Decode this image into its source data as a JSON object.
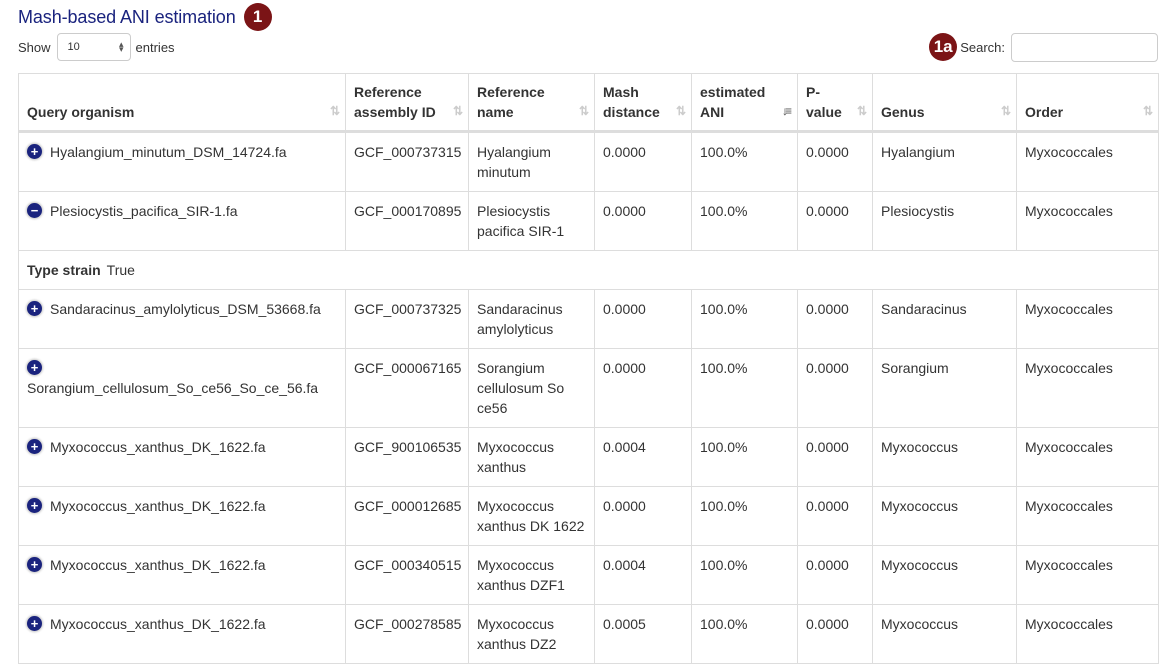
{
  "header": {
    "title": "Mash-based ANI estimation",
    "badge_main": "1",
    "badge_search": "1a"
  },
  "length_control": {
    "prefix": "Show",
    "selected": "10",
    "suffix": "entries"
  },
  "search": {
    "label": "Search:",
    "value": "",
    "placeholder": ""
  },
  "table": {
    "columns": [
      {
        "label": "Query organism",
        "sort": "both"
      },
      {
        "label": "Reference assembly ID",
        "sort": "both"
      },
      {
        "label": "Reference name",
        "sort": "both"
      },
      {
        "label": "Mash distance",
        "sort": "both"
      },
      {
        "label": "estimated ANI",
        "sort": "desc"
      },
      {
        "label": "P-value",
        "sort": "both"
      },
      {
        "label": "Genus",
        "sort": "both"
      },
      {
        "label": "Order",
        "sort": "both"
      }
    ],
    "rows": [
      {
        "expanded": false,
        "query": "Hyalangium_minutum_DSM_14724.fa",
        "assembly": "GCF_000737315",
        "name": "Hyalangium minutum",
        "distance": "0.0000",
        "ani": "100.0%",
        "pvalue": "0.0000",
        "genus": "Hyalangium",
        "order": "Myxococcales"
      },
      {
        "expanded": true,
        "query": "Plesiocystis_pacifica_SIR-1.fa",
        "assembly": "GCF_000170895",
        "name": "Plesiocystis pacifica SIR-1",
        "distance": "0.0000",
        "ani": "100.0%",
        "pvalue": "0.0000",
        "genus": "Plesiocystis",
        "order": "Myxococcales"
      },
      {
        "expanded": false,
        "query": "Sandaracinus_amylolyticus_DSM_53668.fa",
        "assembly": "GCF_000737325",
        "name": "Sandaracinus amylolyticus",
        "distance": "0.0000",
        "ani": "100.0%",
        "pvalue": "0.0000",
        "genus": "Sandaracinus",
        "order": "Myxococcales"
      },
      {
        "expanded": false,
        "query": "Sorangium_cellulosum_So_ce56_So_ce_56.fa",
        "assembly": "GCF_000067165",
        "name": "Sorangium cellulosum So ce56",
        "distance": "0.0000",
        "ani": "100.0%",
        "pvalue": "0.0000",
        "genus": "Sorangium",
        "order": "Myxococcales"
      },
      {
        "expanded": false,
        "query": "Myxococcus_xanthus_DK_1622.fa",
        "assembly": "GCF_900106535",
        "name": "Myxococcus xanthus",
        "distance": "0.0004",
        "ani": "100.0%",
        "pvalue": "0.0000",
        "genus": "Myxococcus",
        "order": "Myxococcales"
      },
      {
        "expanded": false,
        "query": "Myxococcus_xanthus_DK_1622.fa",
        "assembly": "GCF_000012685",
        "name": "Myxococcus xanthus DK 1622",
        "distance": "0.0000",
        "ani": "100.0%",
        "pvalue": "0.0000",
        "genus": "Myxococcus",
        "order": "Myxococcales"
      },
      {
        "expanded": false,
        "query": "Myxococcus_xanthus_DK_1622.fa",
        "assembly": "GCF_000340515",
        "name": "Myxococcus xanthus DZF1",
        "distance": "0.0004",
        "ani": "100.0%",
        "pvalue": "0.0000",
        "genus": "Myxococcus",
        "order": "Myxococcales"
      },
      {
        "expanded": false,
        "query": "Myxococcus_xanthus_DK_1622.fa",
        "assembly": "GCF_000278585",
        "name": "Myxococcus xanthus DZ2",
        "distance": "0.0005",
        "ani": "100.0%",
        "pvalue": "0.0000",
        "genus": "Myxococcus",
        "order": "Myxococcales"
      }
    ],
    "child_row": {
      "after_row": 1,
      "label": "Type strain",
      "value": "True"
    }
  },
  "icons": {
    "expand": "+",
    "collapse": "−",
    "sort_both": "⇅",
    "sort_desc": "↓≡"
  }
}
